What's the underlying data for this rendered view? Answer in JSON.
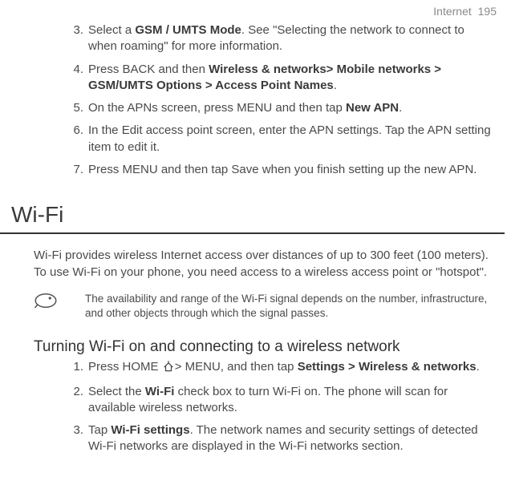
{
  "header": {
    "section": "Internet",
    "page": "195"
  },
  "top_list": [
    {
      "n": "3.",
      "pre": "Select a ",
      "b1": "GSM / UMTS Mode",
      "post": ". See \"Selecting the network to connect to when roaming\" for more information."
    },
    {
      "n": "4.",
      "pre": "Press BACK and then ",
      "b1": "Wireless & networks> Mobile networks > GSM/UMTS Options > Access Point Names",
      "post": "."
    },
    {
      "n": "5.",
      "pre": "On the APNs screen, press MENU and then tap ",
      "b1": "New APN",
      "post": "."
    },
    {
      "n": "6.",
      "pre": "In the Edit access point screen, enter the APN settings. Tap the APN setting item to edit it.",
      "b1": "",
      "post": ""
    },
    {
      "n": "7.",
      "pre": "Press MENU and then tap Save when you finish setting up the new APN.",
      "b1": "",
      "post": ""
    }
  ],
  "wifi": {
    "title": "Wi-Fi",
    "intro": "Wi-Fi provides wireless Internet access over distances of up to 300 feet (100 meters). To use Wi-Fi on your phone, you need access to a wireless access point or \"hotspot\".",
    "note": "The availability and range of the Wi-Fi signal depends on the number, infrastructure, and other objects through which the signal passes.",
    "subheading": "Turning Wi-Fi on and connecting to a wireless network",
    "steps": [
      {
        "n": "1.",
        "pre": "Press HOME ",
        "mid": "> MENU, and then tap ",
        "b1": "Settings > Wireless & networks",
        "post": ".",
        "hasHome": true
      },
      {
        "n": "2.",
        "pre": "Select the ",
        "b1": "Wi-Fi",
        "post": " check box to turn Wi-Fi on. The phone will scan for available wireless networks.",
        "hasHome": false,
        "mid": ""
      },
      {
        "n": "3.",
        "pre": "Tap ",
        "b1": "Wi-Fi settings",
        "post": ". The network names and security settings of detected Wi-Fi networks are displayed in the Wi-Fi networks section.",
        "hasHome": false,
        "mid": ""
      }
    ]
  }
}
